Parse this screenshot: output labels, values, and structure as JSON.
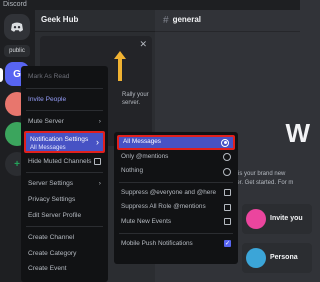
{
  "window": {
    "title": "Discord"
  },
  "servers": {
    "tag": "public",
    "active_initial": "G"
  },
  "server": {
    "name": "Geek Hub",
    "close_icon": "close-icon",
    "promo_text": "Rally your server."
  },
  "channel": {
    "name": "general",
    "welcome": "W",
    "welcome_sub": "This is your brand new server. Get started. For m",
    "card1": "Invite you",
    "card2": "Persona"
  },
  "context_menu": {
    "items": [
      {
        "label": "Mark As Read"
      },
      {
        "label": "Invite People"
      },
      {
        "label": "Mute Server"
      },
      {
        "label": "Notification Settings",
        "sub": "All Messages"
      },
      {
        "label": "Hide Muted Channels"
      },
      {
        "label": "Server Settings"
      },
      {
        "label": "Privacy Settings"
      },
      {
        "label": "Edit Server Profile"
      },
      {
        "label": "Create Channel"
      },
      {
        "label": "Create Category"
      },
      {
        "label": "Create Event"
      }
    ]
  },
  "notification_menu": {
    "items": [
      {
        "label": "All Messages"
      },
      {
        "label": "Only @mentions"
      },
      {
        "label": "Nothing"
      },
      {
        "label": "Suppress @everyone and @here"
      },
      {
        "label": "Suppress All Role @mentions"
      },
      {
        "label": "Mute New Events"
      },
      {
        "label": "Mobile Push Notifications"
      }
    ]
  },
  "colors": {
    "accent": "#4752c4",
    "highlight_border": "#e0201e",
    "bg": "#313338"
  }
}
